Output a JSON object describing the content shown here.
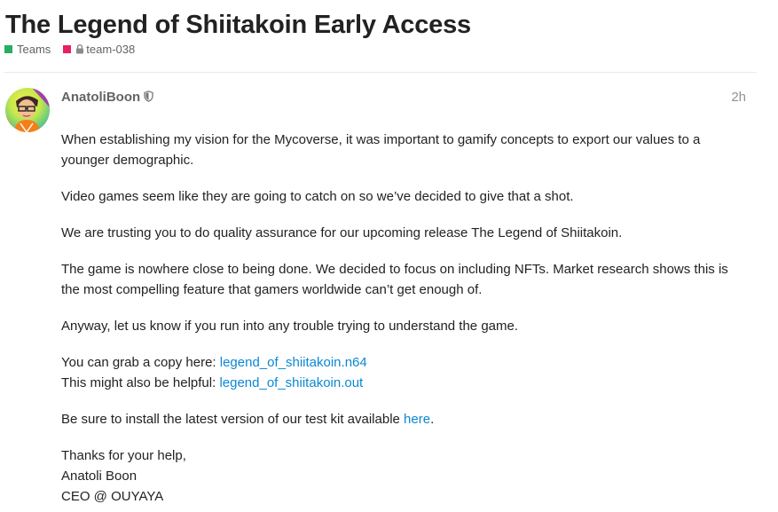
{
  "topic": {
    "title": "The Legend of Shiitakoin Early Access",
    "categories": [
      {
        "label": "Teams",
        "color": "#27ae60"
      },
      {
        "label": "team-038",
        "color": "#e91e63",
        "icon": "lock-icon"
      }
    ]
  },
  "post": {
    "author": "AnatoliBoon",
    "author_badge_icon": "shield-icon",
    "date": "2h",
    "link_color": "#0a88d4",
    "paragraphs": {
      "p1": "When establishing my vision for the Mycoverse, it was important to gamify concepts to export our values to a younger demographic.",
      "p2": "Video games seem like they are going to catch on so we’ve decided to give that a shot.",
      "p3": "We are trusting you to do quality assurance for our upcoming release The Legend of Shiitakoin.",
      "p4": "The game is nowhere close to being done. We decided to focus on including NFTs. Market research shows this is the most compelling feature that gamers worldwide can’t get enough of.",
      "p5": "Anyway, let us know if you run into any trouble trying to understand the game."
    },
    "downloads": {
      "copy_prefix": "You can grab a copy here: ",
      "copy_link": "legend_of_shiitakoin.n64",
      "helpful_prefix": "This might also be helpful: ",
      "helpful_link": "legend_of_shiitakoin.out"
    },
    "testkit": {
      "prefix": "Be sure to install the latest version of our test kit available ",
      "link": "here",
      "suffix": "."
    },
    "signoff": {
      "line1": "Thanks for your help,",
      "line2": "Anatoli Boon",
      "line3": "CEO @ OUYAYA"
    }
  }
}
